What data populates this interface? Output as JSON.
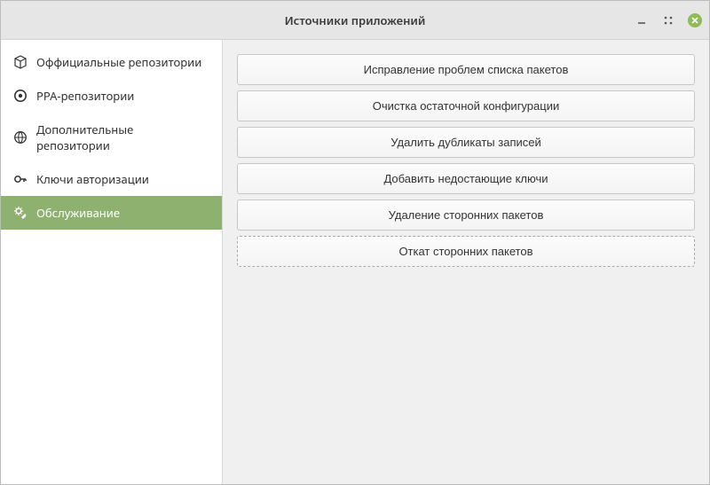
{
  "window": {
    "title": "Источники приложений"
  },
  "sidebar": {
    "items": [
      {
        "label": "Оффициальные репозитории",
        "icon": "box",
        "active": false
      },
      {
        "label": "PPA-репозитории",
        "icon": "ppa",
        "active": false
      },
      {
        "label": "Дополнительные репозитории",
        "icon": "globe",
        "active": false
      },
      {
        "label": "Ключи авторизации",
        "icon": "key",
        "active": false
      },
      {
        "label": "Обслуживание",
        "icon": "wrench",
        "active": true
      }
    ]
  },
  "main": {
    "buttons": [
      "Исправление проблем списка пакетов",
      "Очистка остаточной конфигурации",
      "Удалить дубликаты записей",
      "Добавить недостающие ключи",
      "Удаление сторонних пакетов",
      "Откат сторонних пакетов"
    ]
  }
}
